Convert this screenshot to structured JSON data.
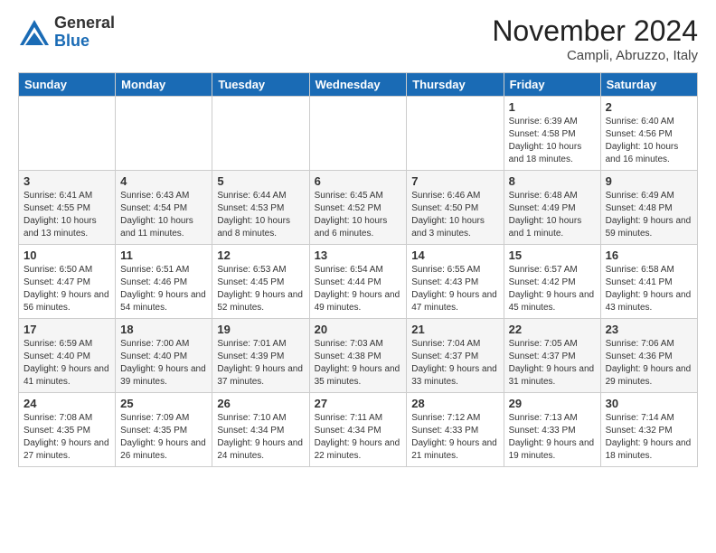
{
  "header": {
    "logo_general": "General",
    "logo_blue": "Blue",
    "month_title": "November 2024",
    "location": "Campli, Abruzzo, Italy"
  },
  "weekdays": [
    "Sunday",
    "Monday",
    "Tuesday",
    "Wednesday",
    "Thursday",
    "Friday",
    "Saturday"
  ],
  "weeks": [
    [
      {
        "day": "",
        "info": ""
      },
      {
        "day": "",
        "info": ""
      },
      {
        "day": "",
        "info": ""
      },
      {
        "day": "",
        "info": ""
      },
      {
        "day": "",
        "info": ""
      },
      {
        "day": "1",
        "info": "Sunrise: 6:39 AM\nSunset: 4:58 PM\nDaylight: 10 hours and 18 minutes."
      },
      {
        "day": "2",
        "info": "Sunrise: 6:40 AM\nSunset: 4:56 PM\nDaylight: 10 hours and 16 minutes."
      }
    ],
    [
      {
        "day": "3",
        "info": "Sunrise: 6:41 AM\nSunset: 4:55 PM\nDaylight: 10 hours and 13 minutes."
      },
      {
        "day": "4",
        "info": "Sunrise: 6:43 AM\nSunset: 4:54 PM\nDaylight: 10 hours and 11 minutes."
      },
      {
        "day": "5",
        "info": "Sunrise: 6:44 AM\nSunset: 4:53 PM\nDaylight: 10 hours and 8 minutes."
      },
      {
        "day": "6",
        "info": "Sunrise: 6:45 AM\nSunset: 4:52 PM\nDaylight: 10 hours and 6 minutes."
      },
      {
        "day": "7",
        "info": "Sunrise: 6:46 AM\nSunset: 4:50 PM\nDaylight: 10 hours and 3 minutes."
      },
      {
        "day": "8",
        "info": "Sunrise: 6:48 AM\nSunset: 4:49 PM\nDaylight: 10 hours and 1 minute."
      },
      {
        "day": "9",
        "info": "Sunrise: 6:49 AM\nSunset: 4:48 PM\nDaylight: 9 hours and 59 minutes."
      }
    ],
    [
      {
        "day": "10",
        "info": "Sunrise: 6:50 AM\nSunset: 4:47 PM\nDaylight: 9 hours and 56 minutes."
      },
      {
        "day": "11",
        "info": "Sunrise: 6:51 AM\nSunset: 4:46 PM\nDaylight: 9 hours and 54 minutes."
      },
      {
        "day": "12",
        "info": "Sunrise: 6:53 AM\nSunset: 4:45 PM\nDaylight: 9 hours and 52 minutes."
      },
      {
        "day": "13",
        "info": "Sunrise: 6:54 AM\nSunset: 4:44 PM\nDaylight: 9 hours and 49 minutes."
      },
      {
        "day": "14",
        "info": "Sunrise: 6:55 AM\nSunset: 4:43 PM\nDaylight: 9 hours and 47 minutes."
      },
      {
        "day": "15",
        "info": "Sunrise: 6:57 AM\nSunset: 4:42 PM\nDaylight: 9 hours and 45 minutes."
      },
      {
        "day": "16",
        "info": "Sunrise: 6:58 AM\nSunset: 4:41 PM\nDaylight: 9 hours and 43 minutes."
      }
    ],
    [
      {
        "day": "17",
        "info": "Sunrise: 6:59 AM\nSunset: 4:40 PM\nDaylight: 9 hours and 41 minutes."
      },
      {
        "day": "18",
        "info": "Sunrise: 7:00 AM\nSunset: 4:40 PM\nDaylight: 9 hours and 39 minutes."
      },
      {
        "day": "19",
        "info": "Sunrise: 7:01 AM\nSunset: 4:39 PM\nDaylight: 9 hours and 37 minutes."
      },
      {
        "day": "20",
        "info": "Sunrise: 7:03 AM\nSunset: 4:38 PM\nDaylight: 9 hours and 35 minutes."
      },
      {
        "day": "21",
        "info": "Sunrise: 7:04 AM\nSunset: 4:37 PM\nDaylight: 9 hours and 33 minutes."
      },
      {
        "day": "22",
        "info": "Sunrise: 7:05 AM\nSunset: 4:37 PM\nDaylight: 9 hours and 31 minutes."
      },
      {
        "day": "23",
        "info": "Sunrise: 7:06 AM\nSunset: 4:36 PM\nDaylight: 9 hours and 29 minutes."
      }
    ],
    [
      {
        "day": "24",
        "info": "Sunrise: 7:08 AM\nSunset: 4:35 PM\nDaylight: 9 hours and 27 minutes."
      },
      {
        "day": "25",
        "info": "Sunrise: 7:09 AM\nSunset: 4:35 PM\nDaylight: 9 hours and 26 minutes."
      },
      {
        "day": "26",
        "info": "Sunrise: 7:10 AM\nSunset: 4:34 PM\nDaylight: 9 hours and 24 minutes."
      },
      {
        "day": "27",
        "info": "Sunrise: 7:11 AM\nSunset: 4:34 PM\nDaylight: 9 hours and 22 minutes."
      },
      {
        "day": "28",
        "info": "Sunrise: 7:12 AM\nSunset: 4:33 PM\nDaylight: 9 hours and 21 minutes."
      },
      {
        "day": "29",
        "info": "Sunrise: 7:13 AM\nSunset: 4:33 PM\nDaylight: 9 hours and 19 minutes."
      },
      {
        "day": "30",
        "info": "Sunrise: 7:14 AM\nSunset: 4:32 PM\nDaylight: 9 hours and 18 minutes."
      }
    ]
  ]
}
